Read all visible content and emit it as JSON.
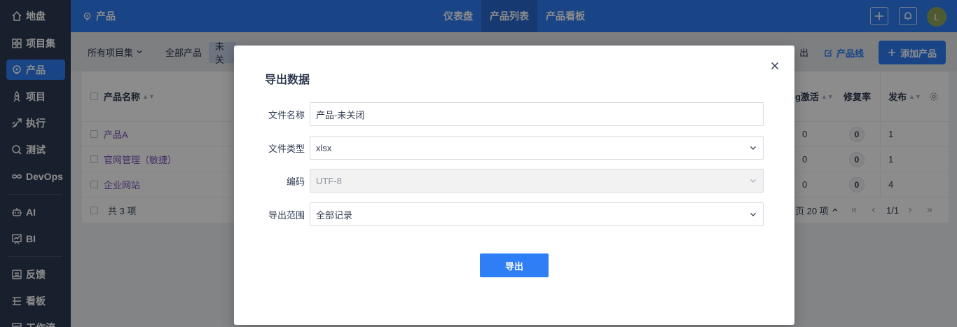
{
  "sidebar": {
    "items": [
      {
        "label": "地盘",
        "icon": "home-icon"
      },
      {
        "label": "项目集",
        "icon": "grid-icon"
      },
      {
        "label": "产品",
        "icon": "product-icon"
      },
      {
        "label": "项目",
        "icon": "rocket-icon"
      },
      {
        "label": "执行",
        "icon": "execution-icon"
      },
      {
        "label": "测试",
        "icon": "test-icon"
      },
      {
        "label": "DevOps",
        "icon": "infinity-icon"
      },
      {
        "label": "AI",
        "icon": "robot-icon"
      },
      {
        "label": "BI",
        "icon": "chart-icon"
      },
      {
        "label": "反馈",
        "icon": "feedback-icon"
      },
      {
        "label": "看板",
        "icon": "kanban-icon"
      },
      {
        "label": "工作流",
        "icon": "workflow-icon"
      }
    ]
  },
  "header": {
    "breadcrumb": "产品",
    "tabs": [
      {
        "label": "仪表盘"
      },
      {
        "label": "产品列表"
      },
      {
        "label": "产品看板"
      }
    ],
    "avatar_initial": "L"
  },
  "subnav": {
    "project_set": "所有项目集",
    "filter_all": "全部产品",
    "filter_active": "未关",
    "export_partial": "出",
    "product_line": "产品线",
    "add_product": "添加产品"
  },
  "table": {
    "headers": {
      "name": "产品名称",
      "bug_active": "ug激活",
      "fix_rate": "修复率",
      "release": "发布"
    },
    "rows": [
      {
        "name": "产品A",
        "bug_active": "0",
        "fix_rate": "0",
        "release": "1"
      },
      {
        "name": "官网管理（敏捷）",
        "bug_active": "0",
        "fix_rate": "0",
        "release": "1"
      },
      {
        "name": "企业网站",
        "bug_active": "0",
        "fix_rate": "0",
        "release": "4"
      }
    ],
    "footer": {
      "total": "共 3 项",
      "page_size": "页 20 项",
      "page": "1/1"
    }
  },
  "modal": {
    "title": "导出数据",
    "fields": {
      "filename": {
        "label": "文件名称",
        "value": "产品-未关闭"
      },
      "filetype": {
        "label": "文件类型",
        "value": "xlsx"
      },
      "encoding": {
        "label": "编码",
        "value": "UTF-8"
      },
      "range": {
        "label": "导出范围",
        "value": "全部记录"
      }
    },
    "submit": "导出"
  },
  "colors": {
    "primary": "#2e7ef5",
    "sidebar": "#2c3a52",
    "avatar": "#8ea65a"
  }
}
